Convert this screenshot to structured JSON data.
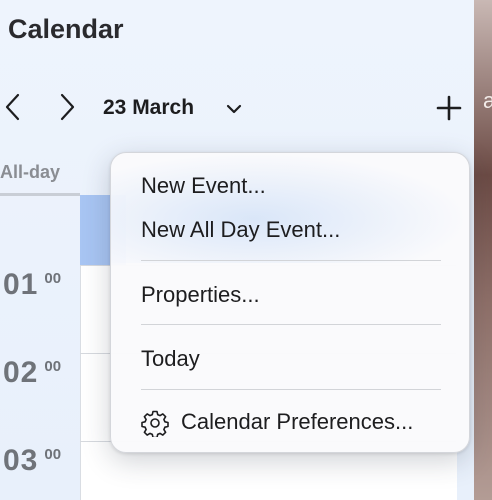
{
  "app": {
    "title": "Calendar"
  },
  "header": {
    "date_label": "23 March",
    "prev_icon": "chevron-left-icon",
    "next_icon": "chevron-right-icon",
    "dropdown_icon": "chevron-down-icon",
    "add_icon": "plus-icon"
  },
  "day_view": {
    "all_day_label": "All-day",
    "hours": [
      {
        "hour": "01",
        "minutes": "00"
      },
      {
        "hour": "02",
        "minutes": "00"
      },
      {
        "hour": "03",
        "minutes": "00"
      }
    ]
  },
  "edge_peek_text": "a",
  "context_menu": {
    "items": [
      {
        "label": "New Event..."
      },
      {
        "label": "New All Day Event..."
      },
      {
        "label": "Properties..."
      },
      {
        "label": "Today"
      },
      {
        "label": "Calendar Preferences...",
        "icon": "gear-icon"
      }
    ]
  },
  "colors": {
    "event_block": "#a8c5f3",
    "panel_background": "#eef4fd"
  }
}
